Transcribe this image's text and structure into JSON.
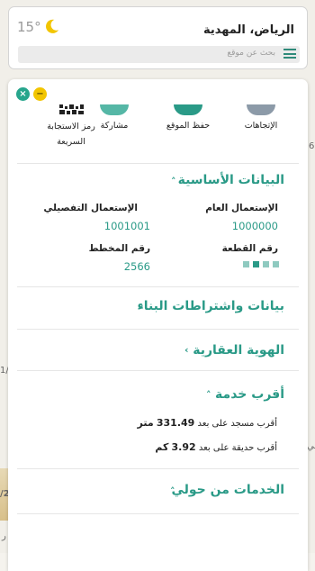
{
  "weather": {
    "temperature": "15°",
    "icon": "moon-icon",
    "icon_color": "#f2c500"
  },
  "location": {
    "title": "الرياض، المهدية"
  },
  "search": {
    "placeholder": "بحث عن موقع"
  },
  "colors": {
    "accent": "#2a9a87",
    "close": "#27a58c",
    "minimize": "#f2c500"
  },
  "map_edges": {
    "label_a": "6",
    "label_b": "1/2",
    "label_c": "/2",
    "label_d": "جي",
    "label_e": "ر"
  },
  "actions": [
    {
      "label": "الإتجاهات",
      "icon": "directions-icon",
      "color": "#8c9aa8"
    },
    {
      "label": "حفظ الموقع",
      "icon": "bookmark-icon",
      "color": "#2a9a87"
    },
    {
      "label": "مشاركة",
      "icon": "share-icon",
      "color": "#55b7a6"
    },
    {
      "label": "رمز الاستجابة السريعة",
      "icon": "qr-code-icon",
      "color": "#222222"
    }
  ],
  "basic_info": {
    "title": "البيانات الأساسية",
    "general_use_label": "الإستعمال العام",
    "general_use_value": "1000000",
    "detailed_use_label": "الإستعمال التفصيلي",
    "detailed_use_value": "1001001",
    "parcel_label": "رقم القطعة",
    "plan_label": "رقم المخطط",
    "plan_value": "2566"
  },
  "building": {
    "title": "بيانات واشتراطات البناء"
  },
  "identity": {
    "title": "الهوية العقارية"
  },
  "nearest": {
    "title": "أقرب خدمة",
    "mosque_prefix": "أقرب مسجد على بعد",
    "mosque_distance": "331.49",
    "mosque_unit": "متر",
    "park_prefix": "أقرب حديقة على بعد",
    "park_distance": "3.92",
    "park_unit": "كم"
  },
  "services_around": {
    "title": "الخدمات من حولي"
  }
}
